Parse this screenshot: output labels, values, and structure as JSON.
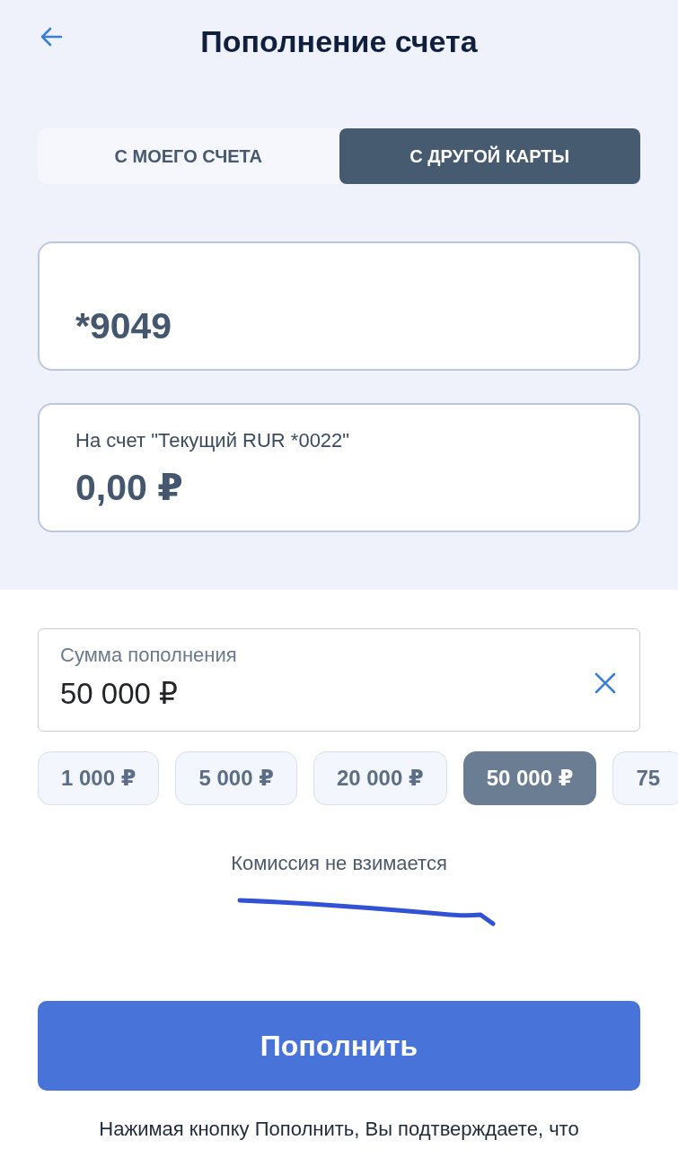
{
  "header": {
    "title": "Пополнение счета"
  },
  "tabs": [
    {
      "label": "С МОЕГО СЧЕТА",
      "selected": false
    },
    {
      "label": "С ДРУГОЙ КАРТЫ",
      "selected": true
    }
  ],
  "source_card": {
    "value": "*9049"
  },
  "target_account": {
    "label": "На счет \"Текущий RUR *0022\"",
    "value": "0,00 ₽"
  },
  "amount_field": {
    "label": "Сумма пополнения",
    "value": "50 000 ₽"
  },
  "amount_chips": [
    {
      "label": "1 000 ₽",
      "selected": false
    },
    {
      "label": "5 000 ₽",
      "selected": false
    },
    {
      "label": "20 000 ₽",
      "selected": false
    },
    {
      "label": "50 000 ₽",
      "selected": true
    },
    {
      "label": "75",
      "selected": false
    }
  ],
  "commission": "Комиссия не взимается",
  "submit_button": "Пополнить",
  "footer_note": "Нажимая кнопку Пополнить, Вы подтверждаете, что"
}
